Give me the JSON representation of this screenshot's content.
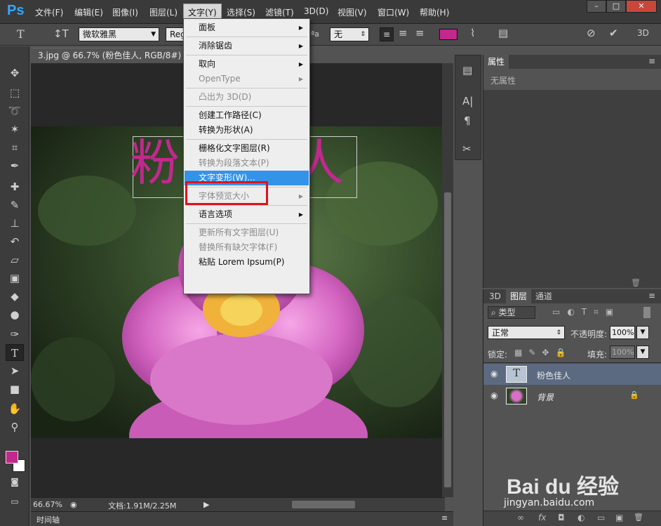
{
  "app": {
    "logo": "Ps"
  },
  "menubar": {
    "items": [
      "文件(F)",
      "编辑(E)",
      "图像(I)",
      "图层(L)",
      "文字(Y)",
      "选择(S)",
      "滤镜(T)",
      "3D(D)",
      "视图(V)",
      "窗口(W)",
      "帮助(H)"
    ],
    "window_buttons": [
      "–",
      "□",
      "✕"
    ]
  },
  "options": {
    "font_family": "微软雅黑",
    "font_style": "Regular",
    "aa_label": "ªa",
    "aa_value": "无",
    "text_color": "#c2288e"
  },
  "document": {
    "tab_title": "3.jpg @ 66.7% (粉色佳人, RGB/8#) *",
    "canvas_text": "粉色佳人",
    "text_color": "#c2288e"
  },
  "status": {
    "zoom": "66.67%",
    "doc_info": "文档:1.91M/2.25M"
  },
  "timeline": {
    "label": "时间轴"
  },
  "properties": {
    "tab": "属性",
    "empty_text": "无属性"
  },
  "layers_panel": {
    "tabs": [
      "3D",
      "图层",
      "通道"
    ],
    "filter_label": "类型",
    "blend_mode": "正常",
    "opacity_label": "不透明度:",
    "opacity_value": "100%",
    "lock_label": "锁定:",
    "fill_label": "填充:",
    "fill_value": "100%",
    "layers": [
      {
        "name": "粉色佳人",
        "type": "text",
        "thumb_glyph": "T",
        "selected": true
      },
      {
        "name": "背景",
        "type": "image",
        "locked": true,
        "selected": false
      }
    ],
    "bottom_icons": [
      "∞",
      "fx",
      "◘",
      "◐",
      "▭",
      "▣",
      "🗑"
    ]
  },
  "text_menu": {
    "items": [
      {
        "label": "面板",
        "submenu": true,
        "enabled": true
      },
      {
        "sep": true
      },
      {
        "label": "消除锯齿",
        "submenu": true,
        "enabled": true
      },
      {
        "sep": true
      },
      {
        "label": "取向",
        "submenu": true,
        "enabled": true
      },
      {
        "label": "OpenType",
        "submenu": true,
        "enabled": false
      },
      {
        "sep": true
      },
      {
        "label": "凸出为 3D(D)",
        "enabled": false
      },
      {
        "sep": true
      },
      {
        "label": "创建工作路径(C)",
        "enabled": true
      },
      {
        "label": "转换为形状(A)",
        "enabled": true
      },
      {
        "sep": true
      },
      {
        "label": "栅格化文字图层(R)",
        "enabled": true
      },
      {
        "label": "转换为段落文本(P)",
        "enabled": false
      },
      {
        "label": "文字变形(W)...",
        "enabled": true,
        "highlighted": true
      },
      {
        "sep": true
      },
      {
        "label": "字体预览大小",
        "submenu": true,
        "enabled": false
      },
      {
        "sep": true
      },
      {
        "label": "语言选项",
        "submenu": true,
        "enabled": true
      },
      {
        "sep": true
      },
      {
        "label": "更新所有文字图层(U)",
        "enabled": false
      },
      {
        "label": "替换所有缺欠字体(F)",
        "enabled": false
      },
      {
        "label": "粘贴 Lorem Ipsum(P)",
        "enabled": true
      }
    ]
  },
  "colors": {
    "foreground": "#c2288e",
    "background": "#ffffff",
    "highlight": "#3393e8",
    "callout": "#e0121a"
  },
  "watermark": {
    "brand": "Bai du 经验",
    "url": "jingyan.baidu.com"
  }
}
